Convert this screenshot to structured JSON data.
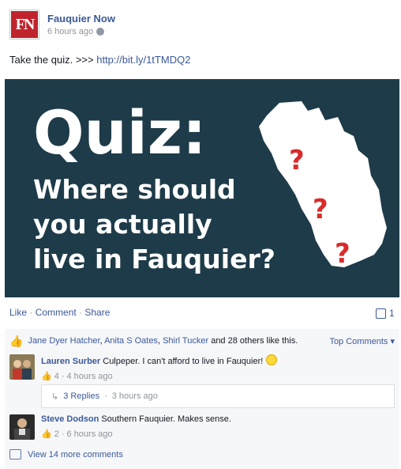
{
  "post": {
    "page_name": "Fauquier Now",
    "logo_text": "FN",
    "timestamp": "6 hours ago",
    "text_prefix": "Take the quiz. >>> ",
    "link": "http://bit.ly/1tTMDQ2"
  },
  "image": {
    "title": "Quiz:",
    "line1": "Where should",
    "line2": "you actually",
    "line3": "live in Fauquier?",
    "marks": [
      "?",
      "?",
      "?"
    ],
    "bg_color": "#1e3b49",
    "mark_color": "#d92b2b"
  },
  "actions": {
    "like": "Like",
    "sep1": " · ",
    "comment": "Comment",
    "sep2": " · ",
    "share": "Share",
    "comment_count": "1"
  },
  "likes": {
    "names": [
      "Jane Dyer Hatcher",
      "Anita S Oates",
      "Shirl Tucker"
    ],
    "comma": ", ",
    "suffix": " and 28 others like this.",
    "top_comments": "Top Comments ▾"
  },
  "comments": [
    {
      "name": "Lauren Surber",
      "text": "Culpeper. I can't afford to live in Fauquier!",
      "likes": "4",
      "time": "4 hours ago",
      "replies": "3 Replies",
      "replies_time": "3 hours ago"
    },
    {
      "name": "Steve Dodson",
      "text": "Southern Fauquier. Makes sense.",
      "likes": "2",
      "time": "6 hours ago"
    }
  ],
  "view_more": "View 14 more comments"
}
